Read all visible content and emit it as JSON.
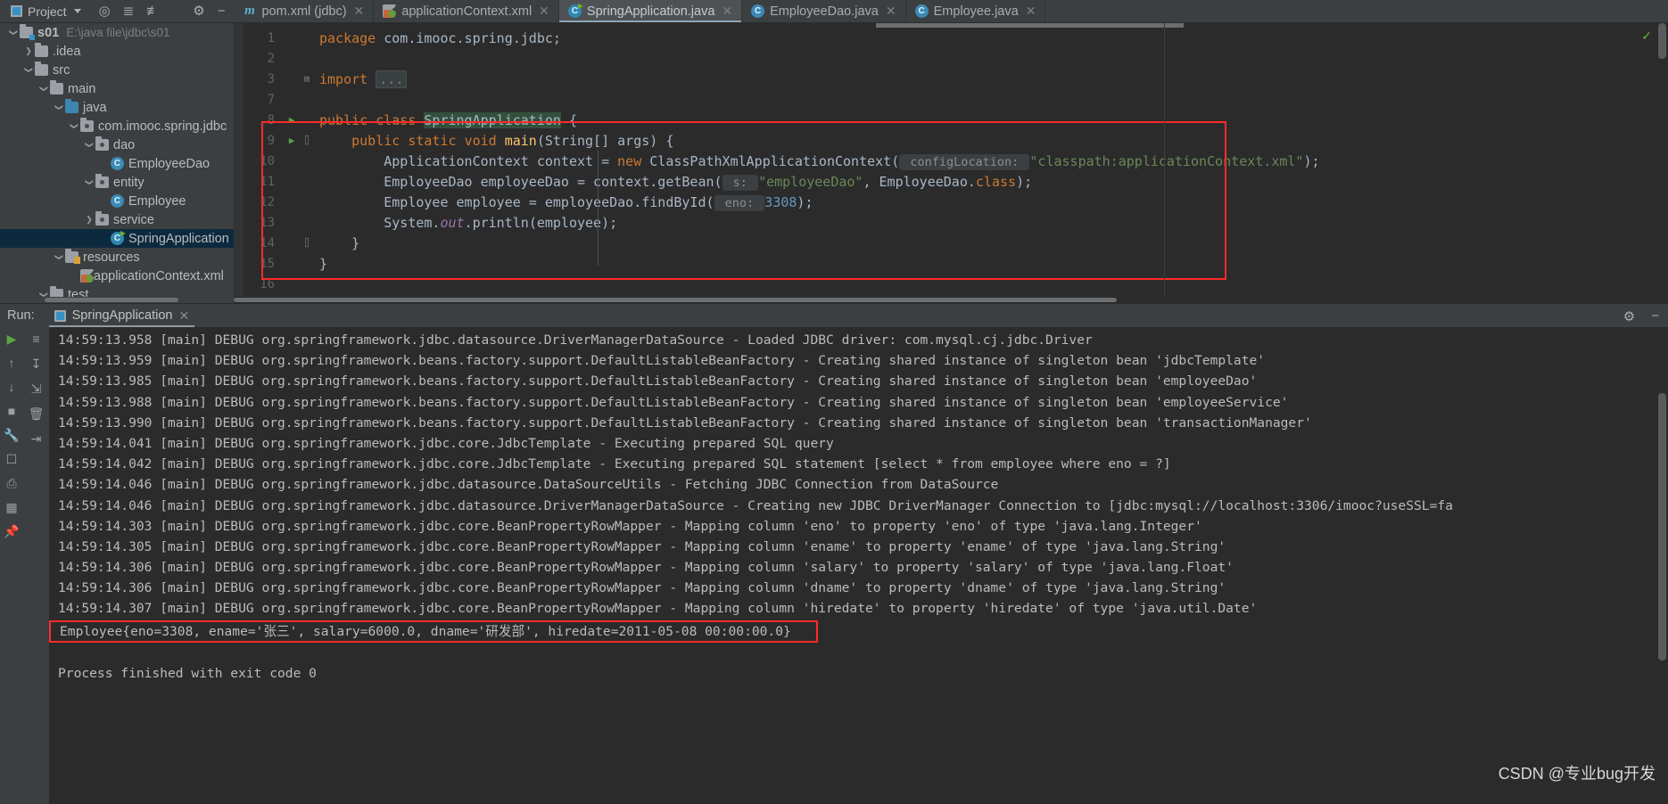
{
  "topbar": {
    "project_button": "Project",
    "icons": [
      "locate-icon",
      "expand-all-icon",
      "collapse-all-icon",
      "gear-icon",
      "hide-icon"
    ],
    "tabs": [
      {
        "label": "pom.xml (jdbc)",
        "icon": "maven-icon",
        "active": false
      },
      {
        "label": "applicationContext.xml",
        "icon": "xml-spring-icon",
        "active": false
      },
      {
        "label": "SpringApplication.java",
        "icon": "java-class-run-icon",
        "active": true
      },
      {
        "label": "EmployeeDao.java",
        "icon": "java-class-icon",
        "active": false
      },
      {
        "label": "Employee.java",
        "icon": "java-class-icon",
        "active": false
      }
    ]
  },
  "sidebar": {
    "tree": [
      {
        "indent": 0,
        "arrow": "down",
        "icon": "module-folder-icon",
        "label": "s01",
        "bold": true,
        "path": "E:\\java file\\jdbc\\s01",
        "selected": false
      },
      {
        "indent": 1,
        "arrow": "right",
        "icon": "folder-icon",
        "label": ".idea",
        "bold": false,
        "path": "",
        "selected": false
      },
      {
        "indent": 1,
        "arrow": "down",
        "icon": "folder-icon",
        "label": "src",
        "bold": false,
        "path": "",
        "selected": false
      },
      {
        "indent": 2,
        "arrow": "down",
        "icon": "folder-icon",
        "label": "main",
        "bold": false,
        "path": "",
        "selected": false
      },
      {
        "indent": 3,
        "arrow": "down",
        "icon": "source-folder-icon",
        "label": "java",
        "bold": false,
        "path": "",
        "selected": false
      },
      {
        "indent": 4,
        "arrow": "down",
        "icon": "package-icon",
        "label": "com.imooc.spring.jdbc",
        "bold": false,
        "path": "",
        "selected": false
      },
      {
        "indent": 5,
        "arrow": "down",
        "icon": "package-icon",
        "label": "dao",
        "bold": false,
        "path": "",
        "selected": false
      },
      {
        "indent": 6,
        "arrow": "none",
        "icon": "java-class-icon",
        "label": "EmployeeDao",
        "bold": false,
        "path": "",
        "selected": false
      },
      {
        "indent": 5,
        "arrow": "down",
        "icon": "package-icon",
        "label": "entity",
        "bold": false,
        "path": "",
        "selected": false
      },
      {
        "indent": 6,
        "arrow": "none",
        "icon": "java-class-icon",
        "label": "Employee",
        "bold": false,
        "path": "",
        "selected": false
      },
      {
        "indent": 5,
        "arrow": "right",
        "icon": "package-icon",
        "label": "service",
        "bold": false,
        "path": "",
        "selected": false
      },
      {
        "indent": 6,
        "arrow": "none",
        "icon": "java-class-run-icon",
        "label": "SpringApplication",
        "bold": false,
        "path": "",
        "selected": true
      },
      {
        "indent": 3,
        "arrow": "down",
        "icon": "resource-folder-icon",
        "label": "resources",
        "bold": false,
        "path": "",
        "selected": false
      },
      {
        "indent": 4,
        "arrow": "none",
        "icon": "xml-spring-icon",
        "label": "applicationContext.xml",
        "bold": false,
        "path": "",
        "selected": false
      },
      {
        "indent": 2,
        "arrow": "down",
        "icon": "folder-icon",
        "label": "test",
        "bold": false,
        "path": "",
        "selected": false
      }
    ]
  },
  "editor": {
    "filename": "SpringApplication.java",
    "line_numbers": [
      "1",
      "2",
      "3",
      "7",
      "8",
      "9",
      "10",
      "11",
      "12",
      "13",
      "14",
      "15",
      "16"
    ],
    "lines": [
      {
        "num": "1",
        "run": false,
        "fold": "",
        "segments": [
          {
            "t": "package ",
            "c": "kw"
          },
          {
            "t": "com.imooc.spring.jdbc;",
            "c": "cls-n"
          }
        ],
        "indent": 0
      },
      {
        "num": "2",
        "run": false,
        "fold": "",
        "segments": [],
        "indent": 0
      },
      {
        "num": "3",
        "run": false,
        "fold": "+",
        "segments": [
          {
            "t": "import ",
            "c": "kw"
          },
          {
            "t": "...",
            "c": "fld"
          }
        ],
        "indent": 0
      },
      {
        "num": "7",
        "run": false,
        "fold": "",
        "segments": [],
        "indent": 0
      },
      {
        "num": "8",
        "run": true,
        "fold": "",
        "segments": [
          {
            "t": "public ",
            "c": "kw"
          },
          {
            "t": "class ",
            "c": "kw"
          },
          {
            "t": "SpringApplication",
            "c": "hl"
          },
          {
            "t": " {",
            "c": "cls-n"
          }
        ],
        "indent": 0
      },
      {
        "num": "9",
        "run": true,
        "fold": "-",
        "segments": [
          {
            "t": "    public ",
            "c": "kw"
          },
          {
            "t": "static ",
            "c": "kw"
          },
          {
            "t": "void ",
            "c": "kw"
          },
          {
            "t": "main",
            "c": "mthb"
          },
          {
            "t": "(",
            "c": "brk"
          },
          {
            "t": "String[] args",
            "c": "cls-n"
          },
          {
            "t": ") {",
            "c": "brk"
          }
        ],
        "indent": 0
      },
      {
        "num": "10",
        "run": false,
        "fold": "",
        "segments": [
          {
            "t": "        ApplicationContext context = ",
            "c": "cls-n"
          },
          {
            "t": "new ",
            "c": "kw"
          },
          {
            "t": "ClassPathXmlApplicationContext",
            "c": "cls-n"
          },
          {
            "t": "(",
            "c": "brk"
          },
          {
            "t": " configLocation: ",
            "c": "hint"
          },
          {
            "t": "\"classpath:applicationContext.xml\"",
            "c": "str"
          },
          {
            "t": ");",
            "c": "brk"
          }
        ],
        "indent": 0
      },
      {
        "num": "11",
        "run": false,
        "fold": "",
        "segments": [
          {
            "t": "        EmployeeDao employeeDao = context.getBean",
            "c": "cls-n"
          },
          {
            "t": "(",
            "c": "brk"
          },
          {
            "t": " s: ",
            "c": "hint"
          },
          {
            "t": "\"employeeDao\"",
            "c": "str"
          },
          {
            "t": ", EmployeeDao.",
            "c": "cls-n"
          },
          {
            "t": "class",
            "c": "kw"
          },
          {
            "t": ");",
            "c": "brk"
          }
        ],
        "indent": 0
      },
      {
        "num": "12",
        "run": false,
        "fold": "",
        "segments": [
          {
            "t": "        Employee employee = employeeDao.findById",
            "c": "cls-n"
          },
          {
            "t": "(",
            "c": "brk"
          },
          {
            "t": " eno: ",
            "c": "hint"
          },
          {
            "t": "3308",
            "c": "num"
          },
          {
            "t": ");",
            "c": "brk"
          }
        ],
        "indent": 0
      },
      {
        "num": "13",
        "run": false,
        "fold": "",
        "segments": [
          {
            "t": "        System.",
            "c": "cls-n"
          },
          {
            "t": "out",
            "c": "ital"
          },
          {
            "t": ".println",
            "c": "cls-n"
          },
          {
            "t": "(",
            "c": "brk"
          },
          {
            "t": "employee",
            "c": "cls-n"
          },
          {
            "t": ");",
            "c": "brk"
          }
        ],
        "indent": 0
      },
      {
        "num": "14",
        "run": false,
        "fold": "-",
        "segments": [
          {
            "t": "    }",
            "c": "brk"
          }
        ],
        "indent": 0
      },
      {
        "num": "15",
        "run": false,
        "fold": "",
        "segments": [
          {
            "t": "}",
            "c": "brk"
          }
        ],
        "indent": 0
      },
      {
        "num": "16",
        "run": false,
        "fold": "",
        "segments": [],
        "indent": 0
      }
    ],
    "inspection_status": "ok-check",
    "highlight_box_color": "#ff2a2a"
  },
  "run_panel": {
    "label": "Run:",
    "tab_label": "SpringApplication",
    "tab_icon": "run-config-icon",
    "close_icon": "close-icon",
    "header_icons": [
      "gear-icon",
      "minimize-icon"
    ],
    "gutter_icons": [
      "run-icon",
      "up-arrow-icon",
      "down-arrow-icon",
      "stop-icon",
      "wrench-icon",
      "soft-wrap-icon",
      "scroll-end-icon",
      "camera-icon",
      "printer-icon",
      "clear-icon",
      "export-icon",
      "table-icon",
      "pin-icon"
    ],
    "console_lines": [
      "14:59:13.958 [main] DEBUG org.springframework.jdbc.datasource.DriverManagerDataSource - Loaded JDBC driver: com.mysql.cj.jdbc.Driver",
      "14:59:13.959 [main] DEBUG org.springframework.beans.factory.support.DefaultListableBeanFactory - Creating shared instance of singleton bean 'jdbcTemplate'",
      "14:59:13.985 [main] DEBUG org.springframework.beans.factory.support.DefaultListableBeanFactory - Creating shared instance of singleton bean 'employeeDao'",
      "14:59:13.988 [main] DEBUG org.springframework.beans.factory.support.DefaultListableBeanFactory - Creating shared instance of singleton bean 'employeeService'",
      "14:59:13.990 [main] DEBUG org.springframework.beans.factory.support.DefaultListableBeanFactory - Creating shared instance of singleton bean 'transactionManager'",
      "14:59:14.041 [main] DEBUG org.springframework.jdbc.core.JdbcTemplate - Executing prepared SQL query",
      "14:59:14.042 [main] DEBUG org.springframework.jdbc.core.JdbcTemplate - Executing prepared SQL statement [select * from employee where eno = ?]",
      "14:59:14.046 [main] DEBUG org.springframework.jdbc.datasource.DataSourceUtils - Fetching JDBC Connection from DataSource",
      "14:59:14.046 [main] DEBUG org.springframework.jdbc.datasource.DriverManagerDataSource - Creating new JDBC DriverManager Connection to [jdbc:mysql://localhost:3306/imooc?useSSL=fa",
      "14:59:14.303 [main] DEBUG org.springframework.jdbc.core.BeanPropertyRowMapper - Mapping column 'eno' to property 'eno' of type 'java.lang.Integer'",
      "14:59:14.305 [main] DEBUG org.springframework.jdbc.core.BeanPropertyRowMapper - Mapping column 'ename' to property 'ename' of type 'java.lang.String'",
      "14:59:14.306 [main] DEBUG org.springframework.jdbc.core.BeanPropertyRowMapper - Mapping column 'salary' to property 'salary' of type 'java.lang.Float'",
      "14:59:14.306 [main] DEBUG org.springframework.jdbc.core.BeanPropertyRowMapper - Mapping column 'dname' to property 'dname' of type 'java.lang.String'",
      "14:59:14.307 [main] DEBUG org.springframework.jdbc.core.BeanPropertyRowMapper - Mapping column 'hiredate' to property 'hiredate' of type 'java.util.Date'"
    ],
    "result_line": "Employee{eno=3308, ename='张三', salary=6000.0, dname='研发部', hiredate=2011-05-08 00:00:00.0}",
    "exit_line": "Process finished with exit code 0"
  },
  "watermark": "CSDN @专业bug开发"
}
